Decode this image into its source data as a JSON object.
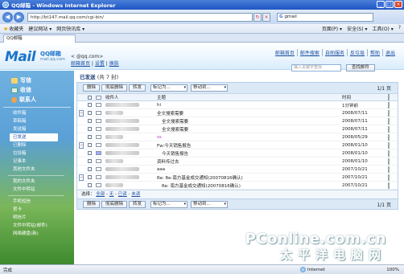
{
  "browser": {
    "title": "QQ邮箱 - Windows Internet Explorer",
    "address": "http://bt147.mail.qq.com/cgi-bin/",
    "search_value": "gmail",
    "favorites_label": "收藏夹",
    "fav_items": [
      "建议网站 ▾",
      "网页快讯库 ▾"
    ],
    "cmd_items": [
      "页面(P) ▾",
      "安全(S) ▾",
      "工具(O) ▾",
      "?"
    ],
    "tab_label": "QQ邮箱",
    "status_left": "完成",
    "status_zone": "Internet",
    "status_zoom": "100%"
  },
  "header": {
    "logo_main": "Mail",
    "logo_qq": "QQ邮箱",
    "logo_domain": "mail.qq.com",
    "user_line": "<              @qq.com>",
    "user_links": [
      "邮箱首页",
      "设置",
      "换肤"
    ],
    "top_links": [
      "邮箱首页",
      "邮件搜索",
      "自助服务",
      "反垃圾",
      "帮助",
      "退出"
    ],
    "search_placeholder": "输入关键字查找",
    "search_button": "查找邮件"
  },
  "sidebar": {
    "main_items": [
      "写信",
      "收信",
      "联系人"
    ],
    "folders_group1": [
      "收件箱",
      "草稿箱",
      "发送箱",
      "已发送",
      "已删除",
      "垃圾箱",
      "记事本",
      "其他文件夹"
    ],
    "folders_group2": [
      "我的文件夹",
      "文件中转站"
    ],
    "folders_group3": [
      "手机短信",
      "贺卡",
      "明信片",
      "文件中转站(邮件)",
      "网络硬盘(新)"
    ],
    "active_folder": "已发送"
  },
  "main": {
    "folder_title": "已发送",
    "folder_count": "(共 7 封)",
    "toolbar": {
      "delete": "删除",
      "perm_delete": "彻底删除",
      "forward": "转发",
      "mark_as": "标记为...",
      "move_to": "移动到..."
    },
    "page_indicator": "1/1 页",
    "columns": {
      "from": "收件人",
      "subject": "主题",
      "time": "时间"
    },
    "rows": [
      {
        "exp": "",
        "subject": "hi",
        "time": "1分钟前",
        "style": ""
      },
      {
        "exp": "−",
        "subject": "全文搜索需要",
        "time": "2008/07/11",
        "style": ""
      },
      {
        "exp": "",
        "subject": "全文搜索需要",
        "time": "2008/07/11",
        "style": "indent"
      },
      {
        "exp": "",
        "subject": "全文搜索需要",
        "time": "2008/07/11",
        "style": "indent"
      },
      {
        "exp": "",
        "subject": "ss",
        "time": "2008/05/29",
        "style": "purple"
      },
      {
        "exp": "−",
        "subject": "Fw:今天销售报告",
        "time": "2008/01/10",
        "style": ""
      },
      {
        "exp": "",
        "subject": "今天销售报告",
        "time": "2008/01/10",
        "style": "indent"
      },
      {
        "exp": "",
        "subject": "资料传过去",
        "time": "2008/01/10",
        "style": ""
      },
      {
        "exp": "",
        "subject": "aaa",
        "time": "2007/10/21",
        "style": ""
      },
      {
        "exp": "−",
        "subject": "Re: Re:南方基金成交通知(20070816确认)",
        "time": "2007/10/21",
        "style": ""
      },
      {
        "exp": "",
        "subject": "Re: 南方基金成交通知(20070816确认)",
        "time": "2007/10/21",
        "style": "indent"
      }
    ],
    "select_label": "选择：",
    "select_links": [
      "全部",
      "无",
      "已读",
      "未读"
    ]
  },
  "watermark": {
    "line1": "PConline.com.cn",
    "line2": "太平洋电脑网"
  }
}
